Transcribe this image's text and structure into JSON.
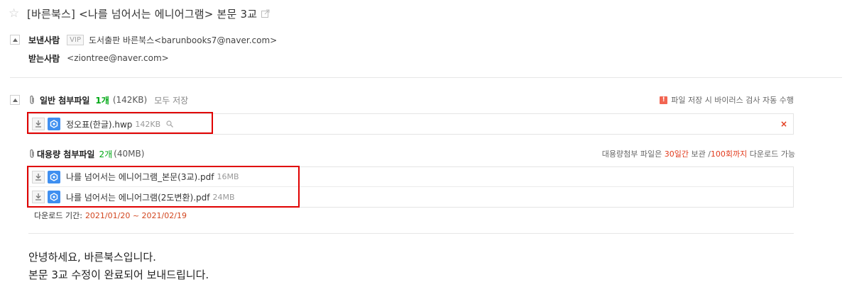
{
  "subject": "[바른북스] <나를 넘어서는 에니어그램> 본문 3교",
  "sender": {
    "label": "보낸사람",
    "vip_badge": "VIP",
    "value": "도서출판 바른북스<barunbooks7@naver.com>"
  },
  "recipient": {
    "label": "받는사람",
    "value": "<ziontree@naver.com>"
  },
  "general_attachments": {
    "title": "일반 첨부파일",
    "count": "1개",
    "total_size": "(142KB)",
    "save_all_label": "모두 저장",
    "virus_note_icon": "!",
    "virus_note": "파일 저장 시 바이러스 검사 자동 수행",
    "files": [
      {
        "name": "정오표(한글).hwp",
        "size": "142KB"
      }
    ],
    "delete_icon": "×"
  },
  "large_attachments": {
    "title": "대용량 첨부파일",
    "count": "2개",
    "total_size": "(40MB)",
    "note_prefix": "대용량첨부 파일은 ",
    "note_days": "30일간",
    "note_mid": " 보관 /",
    "note_times": "100회까지",
    "note_suffix": " 다운로드 가능",
    "files": [
      {
        "name": "나를 넘어서는 에니어그램_본문(3교).pdf",
        "size": "16MB"
      },
      {
        "name": "나를 넘어서는 에니어그램(2도변환).pdf",
        "size": "24MB"
      }
    ],
    "period_label": "다운로드 기간:",
    "period_value": "2021/01/20 ~ 2021/02/19"
  },
  "body": {
    "line1": "안녕하세요, 바른북스입니다.",
    "line2": "본문 3교 수정이 완료되어 보내드립니다."
  },
  "icons": {
    "star": "star-icon",
    "popout": "popout-icon",
    "collapse": "collapse-icon",
    "paperclip": "paperclip-icon",
    "download": "download-icon",
    "cloud": "mybox-cloud-icon",
    "preview": "magnifier-icon",
    "warning": "warning-icon",
    "delete": "close-icon"
  },
  "colors": {
    "count_green": "#00a815",
    "accent_red": "#e23a1c",
    "highlight_red": "#e00000",
    "cloud_blue": "#3f8ff0"
  }
}
